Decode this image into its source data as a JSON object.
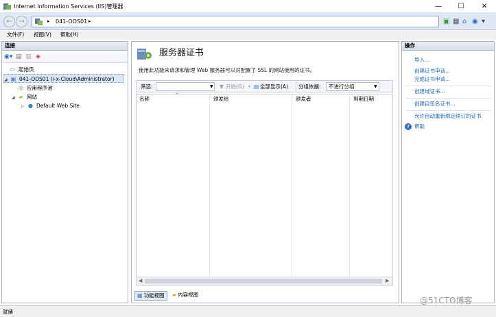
{
  "window": {
    "title": "Internet Information Services (IIS)管理器",
    "controls": {
      "minimize": "—",
      "maximize": "☐",
      "close": "✕"
    }
  },
  "address_bar": {
    "back": "←",
    "forward": "→",
    "separator": "▸",
    "crumb": "041-OOS01"
  },
  "menu": {
    "file": "文件(F)",
    "view": "视图(V)",
    "help": "帮助(H)"
  },
  "connections": {
    "header": "连接",
    "tree": [
      {
        "label": "起始页",
        "icon": "start-page-icon"
      },
      {
        "label": "041-OOS01 (i-x-Cloud\\Administrator)",
        "icon": "server-icon",
        "selected": true
      },
      {
        "label": "应用程序池",
        "icon": "app-pool-icon"
      },
      {
        "label": "网站",
        "icon": "sites-folder-icon"
      },
      {
        "label": "Default Web Site",
        "icon": "globe-icon"
      }
    ]
  },
  "feature": {
    "title": "服务器证书",
    "description": "使用此功能来请求和管理 Web 服务器可以对配置了 SSL 的网站使用的证书。",
    "filter_label": "筛选:",
    "start_label": "开始(G)",
    "show_all_label": "全部显示(A)",
    "group_by_label": "分组依据:",
    "group_by_value": "不进行分组",
    "columns": [
      "名称",
      "颁发给",
      "颁发者",
      "到期日期"
    ],
    "view_tabs": [
      "功能视图",
      "内容视图"
    ]
  },
  "actions": {
    "header": "操作",
    "items": [
      "导入...",
      "创建证书申请...",
      "完成证书申请...",
      "创建域证书...",
      "创建自签名证书...",
      "允许自动重新绑定续订的证书",
      "帮助"
    ]
  },
  "status": {
    "text": "就绪"
  },
  "watermark": "@51CTO博客"
}
